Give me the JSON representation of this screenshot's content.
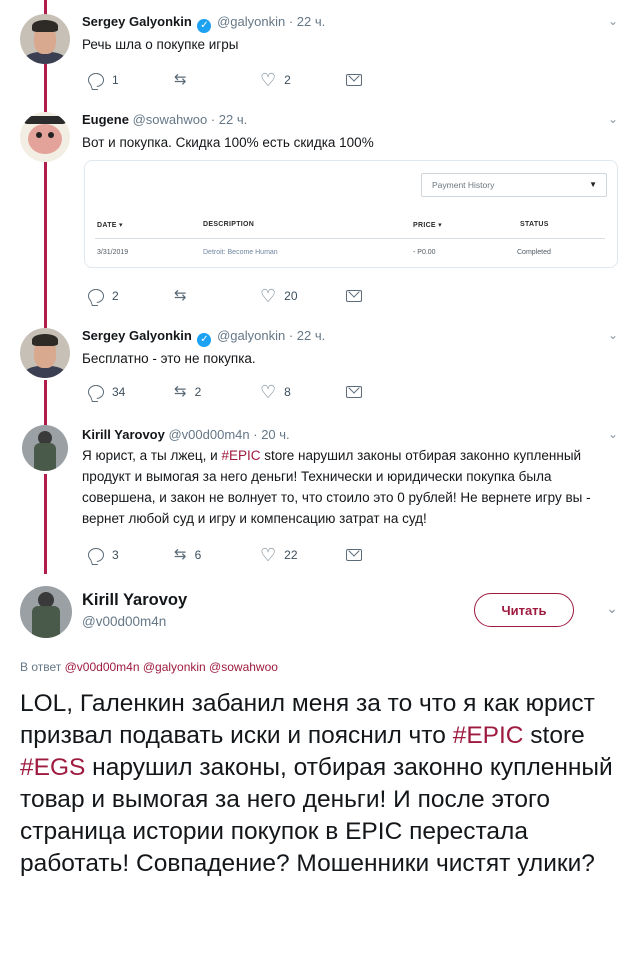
{
  "tweets": [
    {
      "name": "Sergey Galyonkin",
      "handle": "@galyonkin",
      "time": "· 22 ч.",
      "text": "Речь шла о покупке игры",
      "replies": "1",
      "retweets": "",
      "likes": "2"
    },
    {
      "name": "Eugene",
      "handle": "@sowahwoo",
      "time": "· 22 ч.",
      "text": "Вот и покупка. Скидка 100% есть скидка 100%",
      "replies": "2",
      "retweets": "",
      "likes": "20"
    },
    {
      "name": "Sergey Galyonkin",
      "handle": "@galyonkin",
      "time": "· 22 ч.",
      "text": "Бесплатно - это не покупка.",
      "replies": "34",
      "retweets": "2",
      "likes": "8"
    },
    {
      "name": "Kirill Yarovoy",
      "handle": "@v00d00m4n",
      "time": "· 20 ч.",
      "text_before": "Я юрист, а ты лжец, и ",
      "hashtag": "#EPIC",
      "text_after": " store нарушил законы отбирая законно купленный продукт и вымогая за него деньги! Технически и юридически покупка была совершена, и закон не волнует то, что стоило это 0 рублей! Не вернете игру вы - вернет любой суд и игру и компенсацию затрат на суд!",
      "replies": "3",
      "retweets": "6",
      "likes": "22"
    }
  ],
  "payment_card": {
    "dropdown": "Payment History",
    "headers": [
      "DATE ▾",
      "DESCRIPTION",
      "PRICE ▾",
      "STATUS"
    ],
    "row": [
      "3/31/2019",
      "Detroit: Become Human",
      "- P0.00",
      "Completed"
    ]
  },
  "main_tweet": {
    "name": "Kirill Yarovoy",
    "handle": "@v00d00m4n",
    "follow_label": "Читать",
    "replying_prefix": "В ответ",
    "replying_handles": "@v00d00m4n @galyonkin @sowahwoo",
    "text_1": "LOL, Галенкин забанил меня за то что я как юрист призвал подавать иски и пояснил что ",
    "hashtag_1": "#EPIC",
    "text_2": " store ",
    "hashtag_2": "#EGS",
    "text_3": " нарушил законы, отбирая законно купленный товар и вымогая за него деньги! И после этого страница истории покупок в EPIC перестала работать! Совпадение? Мошенники чистят улики?"
  },
  "colors": {
    "accent": "#9e1b3f",
    "thread_line": "#b11d4a",
    "verified": "#1da1f2"
  }
}
